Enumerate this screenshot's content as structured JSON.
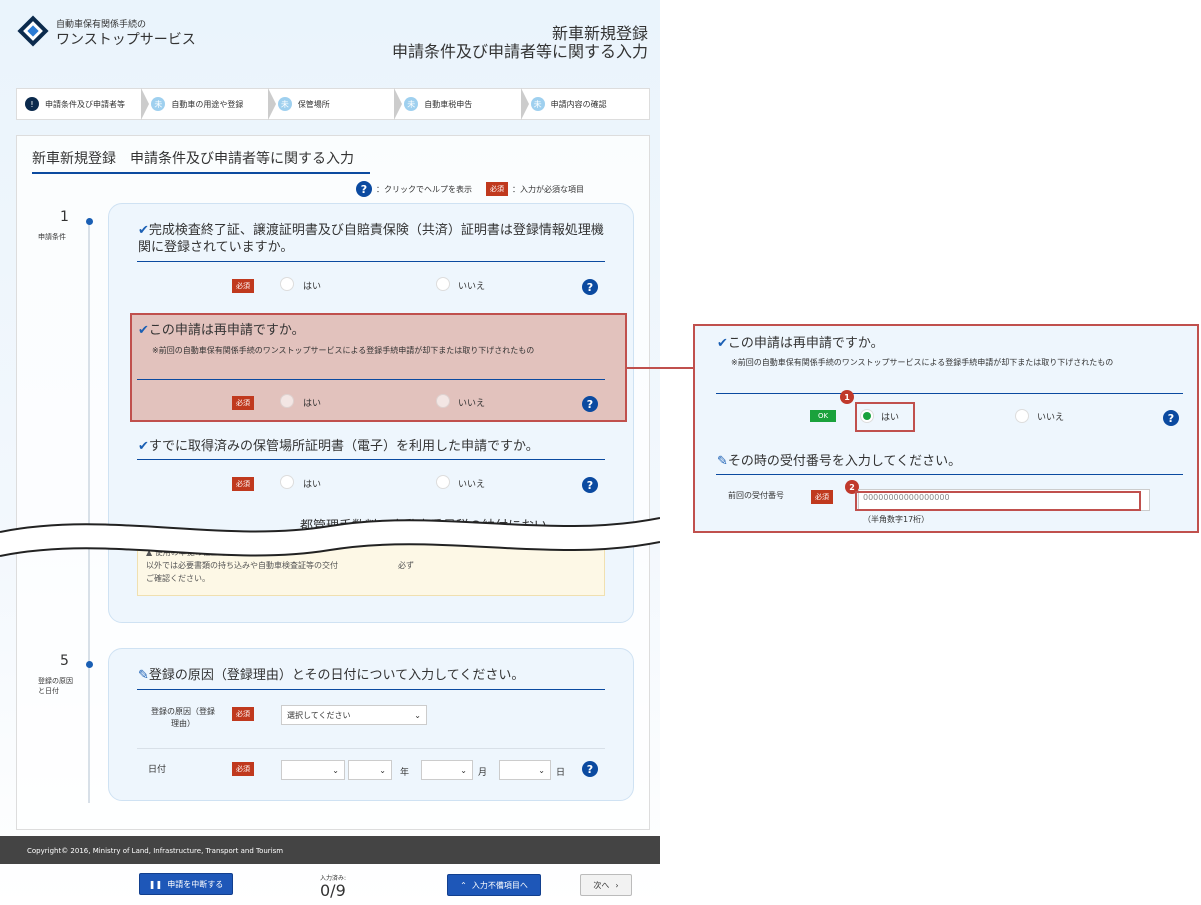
{
  "header": {
    "brand_line1": "自動車保有関係手続の",
    "brand_line2": "ワンストップサービス",
    "title_line1": "新車新規登録",
    "title_line2": "申請条件及び申請者等に関する入力"
  },
  "steps": [
    {
      "badge": "!",
      "label": "申請条件及び申請者等",
      "state": "current"
    },
    {
      "badge": "未",
      "label": "自動車の用途や登録",
      "state": "todo"
    },
    {
      "badge": "未",
      "label": "保管場所",
      "state": "todo"
    },
    {
      "badge": "未",
      "label": "自動車税申告",
      "state": "todo"
    },
    {
      "badge": "未",
      "label": "申請内容の確認",
      "state": "todo"
    }
  ],
  "main": {
    "title": "新車新規登録　申請条件及び申請者等に関する入力",
    "help_text": "：クリックでヘルプを表示",
    "req_badge": "必須",
    "req_text": "：入力が必須な項目"
  },
  "section1": {
    "number": "1",
    "label": "申請条件"
  },
  "section5": {
    "number": "5",
    "label": "登録の原因と日付"
  },
  "questions": {
    "q1": "完成検査終了証、譲渡証明書及び自賠責保険（共済）証明書は登録情報処理機関に登録されていますか。",
    "q2": "この申請は再申請ですか。",
    "q2_note": "※前回の自動車保有関係手続のワンストップサービスによる登録手続申請が却下または取り下げされたもの",
    "q3": "すでに取得済みの保管場所証明書（電子）を利用した申請ですか。",
    "q4_partial": "、自動車重量税の納付におい",
    "q4_partial_prefix": "都管理手数料",
    "yes": "はい",
    "no": "いいえ"
  },
  "warning": {
    "line1": "▲ 使用の本拠の位置を管轄する運輸",
    "line2": "以外では必要書類の持ち込みや自動車検査証等の交付",
    "line2_tail": "必ず",
    "line3": "ご確認ください。"
  },
  "reason": {
    "heading": "登録の原因（登録理由）とその日付について入力してください。",
    "cause_label": "登録の原因（登録理由）",
    "cause_placeholder": "選択してください",
    "date_label": "日付",
    "year": "年",
    "month": "月",
    "day": "日"
  },
  "footer": {
    "copyright": "Copyright© 2016, Ministry of Land, Infrastructure, Transport and Tourism"
  },
  "bottom": {
    "pause": "申請を中断する",
    "progress_label": "入力済み:",
    "progress_value": "0/9",
    "incomplete": "入力不備項目へ",
    "next": "次へ"
  },
  "zoom": {
    "question": "この申請は再申請ですか。",
    "note": "※前回の自動車保有関係手続のワンストップサービスによる登録手続申請が却下または取り下げされたもの",
    "ok_badge": "OK",
    "yes": "はい",
    "no": "いいえ",
    "sub_heading": "その時の受付番号を入力してください。",
    "field_label": "前回の受付番号",
    "req_badge": "必須",
    "placeholder": "00000000000000000",
    "hint": "（半角数字17桁）",
    "pin1": "1",
    "pin2": "2"
  },
  "colors": {
    "accent": "#0b4aa0",
    "required": "#c0391e",
    "ok": "#1aa23c",
    "highlight": "#c0504d"
  }
}
